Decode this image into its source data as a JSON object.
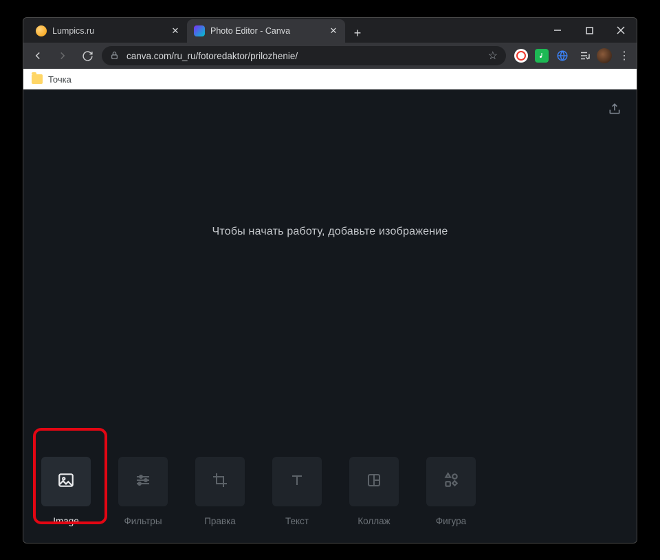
{
  "browser": {
    "tabs": [
      {
        "title": "Lumpics.ru",
        "active": false
      },
      {
        "title": "Photo Editor - Canva",
        "active": true
      }
    ],
    "url": "canva.com/ru_ru/fotoredaktor/prilozhenie/",
    "bookmark": "Точка"
  },
  "editor": {
    "hint": "Чтобы начать работу, добавьте изображение",
    "tools": [
      {
        "label": "Image",
        "icon": "image-icon",
        "active": true
      },
      {
        "label": "Фильтры",
        "icon": "sliders-icon",
        "active": false
      },
      {
        "label": "Правка",
        "icon": "crop-icon",
        "active": false
      },
      {
        "label": "Текст",
        "icon": "text-icon",
        "active": false
      },
      {
        "label": "Коллаж",
        "icon": "collage-icon",
        "active": false
      },
      {
        "label": "Фигура",
        "icon": "shapes-icon",
        "active": false
      }
    ]
  }
}
